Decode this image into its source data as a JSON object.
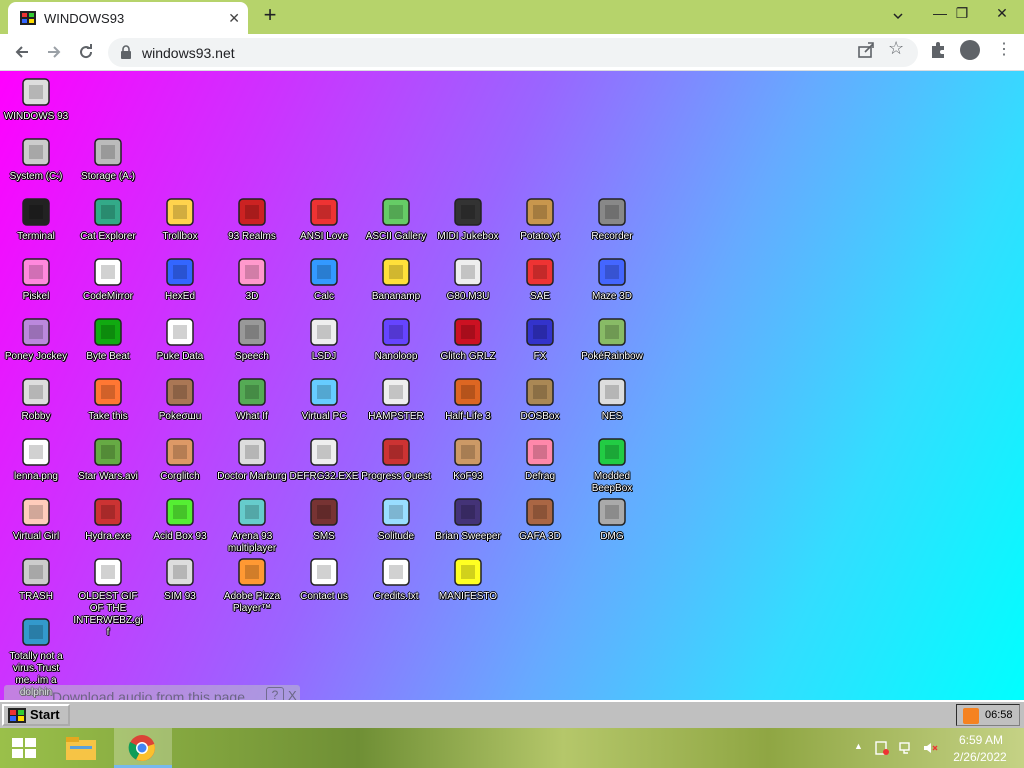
{
  "browser": {
    "tab_title": "WINDOWS93",
    "tab_close": "✕",
    "new_tab": "+",
    "url": "windows93.net",
    "tab_search_icon": "chevron-down-icon",
    "min": "—",
    "max": "❐",
    "close": "✕"
  },
  "desktop": {
    "icons": [
      {
        "label": "WINDOWS 93",
        "icon": "computer-icon"
      },
      {
        "label": "System (C:)",
        "icon": "drive-icon"
      },
      {
        "label": "Storage (A:)",
        "icon": "floppy-drive-icon"
      },
      {
        "label": "Terminal",
        "icon": "terminal-icon"
      },
      {
        "label": "Cat Explorer",
        "icon": "cat-globe-icon"
      },
      {
        "label": "Trollbox",
        "icon": "chat-face-icon"
      },
      {
        "label": "93 Realms",
        "icon": "knight-icon"
      },
      {
        "label": "ANSI Love",
        "icon": "ansi-a-icon"
      },
      {
        "label": "ASCII Gallery",
        "icon": "ascii-123-icon"
      },
      {
        "label": "MIDI Jukebox",
        "icon": "keyboard-icon"
      },
      {
        "label": "Potato.yt",
        "icon": "potato-icon"
      },
      {
        "label": "Recorder",
        "icon": "microphone-icon"
      },
      {
        "label": "Piskel",
        "icon": "palette-icon"
      },
      {
        "label": "CodeMirror",
        "icon": "unicorn-icon"
      },
      {
        "label": "HexEd",
        "icon": "hex-cube-icon"
      },
      {
        "label": "3D",
        "icon": "teapot-icon"
      },
      {
        "label": "Calc",
        "icon": "calculator-icon"
      },
      {
        "label": "Bananamp",
        "icon": "banana-icon"
      },
      {
        "label": "G80.M3U",
        "icon": "audio-file-icon"
      },
      {
        "label": "SAE",
        "icon": "checker-ball-icon"
      },
      {
        "label": "Maze 3D",
        "icon": "maze-icon"
      },
      {
        "label": "Poney Jockey",
        "icon": "pony-icon"
      },
      {
        "label": "Byte Beat",
        "icon": "bytebeat-icon"
      },
      {
        "label": "Puke Data",
        "icon": "puke-data-icon"
      },
      {
        "label": "Speech",
        "icon": "speech-face-icon"
      },
      {
        "label": "LSDJ",
        "icon": "gameboy-icon"
      },
      {
        "label": "Nanoloop",
        "icon": "wave-icon"
      },
      {
        "label": "Glitch GRLZ",
        "icon": "lips-icon"
      },
      {
        "label": "FX",
        "icon": "atom-icon"
      },
      {
        "label": "PokéRainbow",
        "icon": "rainbow-people-icon"
      },
      {
        "label": "Robby",
        "icon": "stickman-icon"
      },
      {
        "label": "Take this",
        "icon": "pixel-man-icon"
      },
      {
        "label": "Pokeσшu",
        "icon": "bag-icon"
      },
      {
        "label": "What If",
        "icon": "barcode-icon"
      },
      {
        "label": "Virtual PC",
        "icon": "window-cursor-icon"
      },
      {
        "label": "HAMPSTER",
        "icon": "owl-icon"
      },
      {
        "label": "Half-Life 3",
        "icon": "lambda-icon"
      },
      {
        "label": "DOSBox",
        "icon": "dosbox-icon"
      },
      {
        "label": "NES",
        "icon": "nes-icon"
      },
      {
        "label": "lenna.png",
        "icon": "image-file-icon"
      },
      {
        "label": "Star Wars.avi",
        "icon": "yoda-icon"
      },
      {
        "label": "Corglitch",
        "icon": "corgi-icon"
      },
      {
        "label": "Doctor Marburg",
        "icon": "doctor-icon"
      },
      {
        "label": "DEFRG32.EXE",
        "icon": "monitor-face-icon"
      },
      {
        "label": "Progress Quest",
        "icon": "swords-icon"
      },
      {
        "label": "KoF93",
        "icon": "fighter-icon"
      },
      {
        "label": "Defrag",
        "icon": "defrag-icon"
      },
      {
        "label": "Modded BeepBox",
        "icon": "green-ring-icon"
      },
      {
        "label": "Virtual Girl",
        "icon": "girl-face-icon"
      },
      {
        "label": "Hydra.exe",
        "icon": "hydra-icon"
      },
      {
        "label": "Acid Box 93",
        "icon": "smiley-icon"
      },
      {
        "label": "Arena 93 multiplayer",
        "icon": "cube-icon"
      },
      {
        "label": "SMS",
        "icon": "sms-console-icon"
      },
      {
        "label": "Solitude",
        "icon": "bottle-icon"
      },
      {
        "label": "Brian Sweeper",
        "icon": "mine-icon"
      },
      {
        "label": "GAFA 3D",
        "icon": "doom-guy-icon"
      },
      {
        "label": "DMG",
        "icon": "disk-stack-icon"
      },
      {
        "label": "TRASH",
        "icon": "trash-icon"
      },
      {
        "label": "OLDEST GIF OF THE INTERWEBZ.gif",
        "icon": "image-file-icon"
      },
      {
        "label": "SIM 93",
        "icon": "book-icon"
      },
      {
        "label": "Adobe Pizza Player™",
        "icon": "pizza-icon"
      },
      {
        "label": "Contact us",
        "icon": "contact-icon"
      },
      {
        "label": "Credits.txt",
        "icon": "text-file-icon"
      },
      {
        "label": "MANIFESTO",
        "icon": "question-icon"
      },
      {
        "label": "Totally not a virus.Trust me...im a dolphin",
        "icon": "dolphin-icon"
      }
    ]
  },
  "download_bar": {
    "text": "Download audio from this page",
    "help": "?",
    "close": "X"
  },
  "taskbar93": {
    "start_label": "Start",
    "clock": "06:58"
  },
  "windows_taskbar": {
    "time": "6:59 AM",
    "date": "2/26/2022",
    "tray_up": "▲"
  }
}
